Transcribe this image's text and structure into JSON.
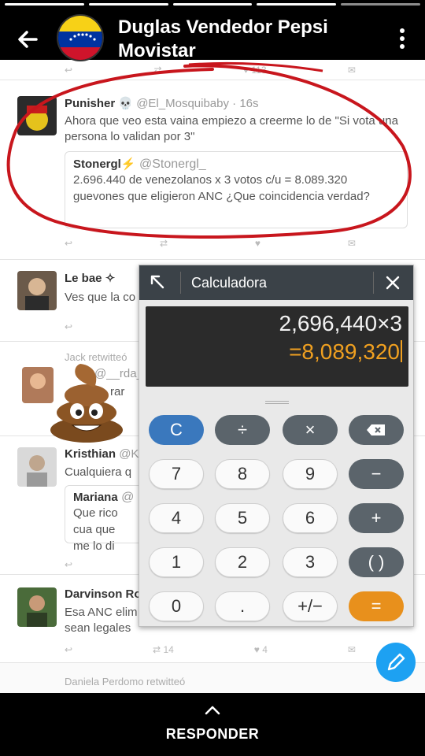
{
  "header": {
    "title": "Duglas Vendedor Pepsi Movistar",
    "back_icon": "arrow-left-icon",
    "menu_icon": "more-vert-icon"
  },
  "tweets": [
    {
      "name": "Punisher",
      "handle": "@El_Mosquibaby · 16s",
      "text": "Ahora que veo esta vaina empiezo a creerme lo de \"Si vota una persona lo validan por 3\"",
      "quote": {
        "name": "Stonergl⚡",
        "handle": "@Stonergl_",
        "text": "2.696.440 de venezolanos x 3 votos c/u = 8.089.320 guevones que eligieron ANC ¿Que coincidencia verdad?"
      }
    },
    {
      "name": "Le bae",
      "text": "Ves que la co"
    },
    {
      "retweet_label": "Jack retwitteó",
      "handle": "@__rda_ · 7",
      "text": "rar"
    },
    {
      "name": "Kristhian",
      "handle": "@K",
      "text": "Cualquiera q",
      "quote": {
        "name": "Mariana",
        "handle": "@",
        "text": "Que rico cua que me lo di"
      }
    },
    {
      "name": "Darvinson Ro",
      "text": "Esa ANC elim vida, etc. Quieren que todas sus ilegalidades sean legales",
      "retweets": "14",
      "likes": "4"
    }
  ],
  "top_actions": {
    "likes": "113"
  },
  "footer_retweet": "Daniela Perdomo retwitteó",
  "calculator": {
    "title": "Calculadora",
    "expression": "2,696,440×3",
    "result": "=8,089,320",
    "keys": {
      "clear": "C",
      "divide": "÷",
      "multiply": "×",
      "backspace": "⌫",
      "minus": "−",
      "plus": "+",
      "parens": "( )",
      "sign": "+/−",
      "equals": "=",
      "dot": ".",
      "n0": "0",
      "n1": "1",
      "n2": "2",
      "n3": "3",
      "n4": "4",
      "n5": "5",
      "n6": "6",
      "n7": "7",
      "n8": "8",
      "n9": "9"
    }
  },
  "bottom": {
    "reply_label": "RESPONDER"
  },
  "colors": {
    "accent_twitter": "#1da1f2",
    "calc_equals": "#e8901c",
    "calc_clear": "#3a78bd",
    "circle_red": "#c8161d"
  }
}
